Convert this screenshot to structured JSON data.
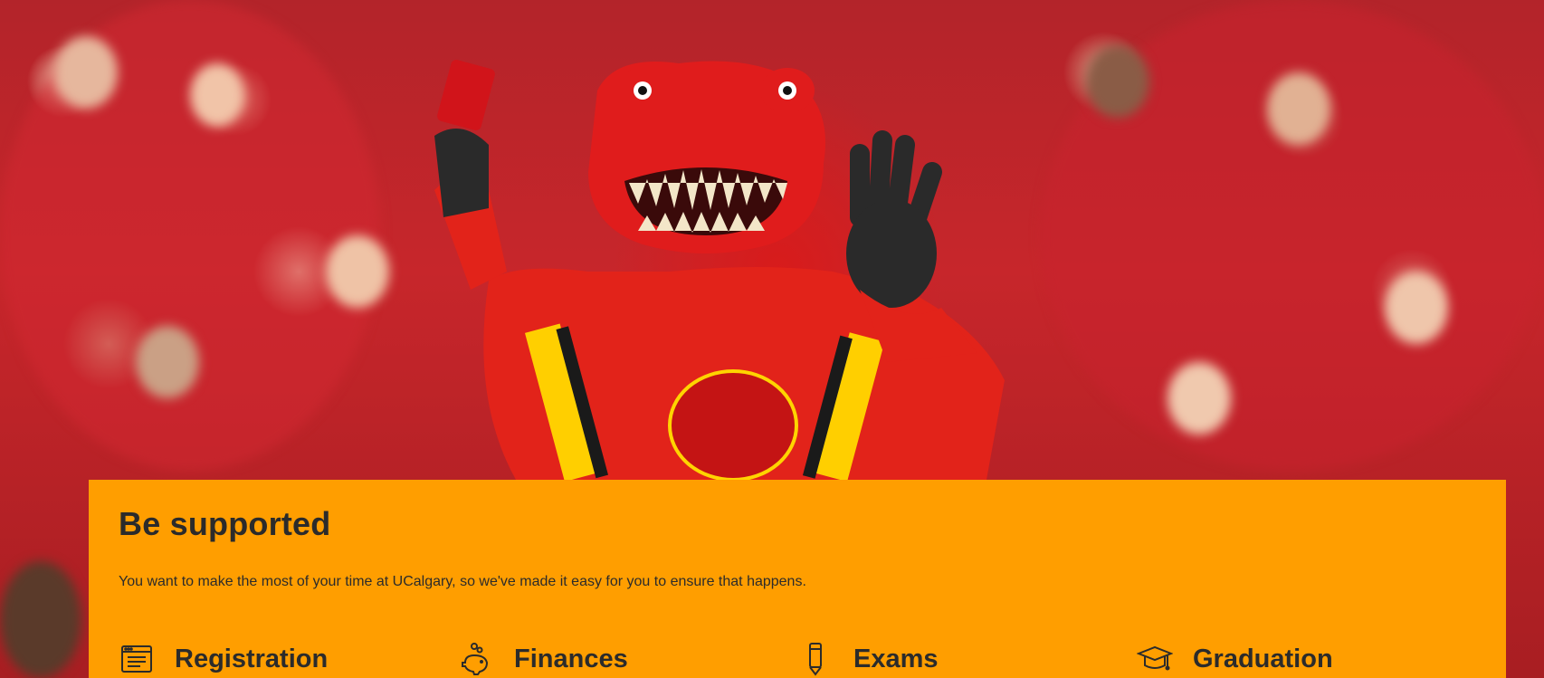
{
  "hero": {
    "image_alt": ""
  },
  "support": {
    "title": "Be supported",
    "description": "You want to make the most of your time at UCalgary, so we've made it easy for you to ensure that happens.",
    "links": [
      {
        "label": "Registration",
        "icon": "registration-icon"
      },
      {
        "label": "Finances",
        "icon": "piggy-bank-icon"
      },
      {
        "label": "Exams",
        "icon": "pencil-icon"
      },
      {
        "label": "Graduation",
        "icon": "graduation-cap-icon"
      }
    ]
  },
  "colors": {
    "card_background": "#ff9e00",
    "text": "#2b2b2b",
    "mascot_red": "#d81b1b"
  }
}
